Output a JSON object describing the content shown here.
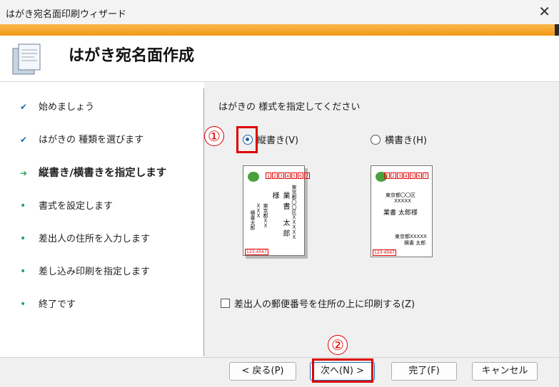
{
  "window": {
    "title": "はがき宛名面印刷ウィザード",
    "close_glyph": "✕"
  },
  "header": {
    "heading": "はがき宛名面作成",
    "icon": "document-icon"
  },
  "steps": [
    {
      "label": "始めましょう",
      "state": "done",
      "mark": "✔"
    },
    {
      "label": "はがきの 種類を選びます",
      "state": "done",
      "mark": "✔"
    },
    {
      "label": "縦書き/横書きを指定します",
      "state": "current",
      "mark": "➔"
    },
    {
      "label": "書式を設定します",
      "state": "todo",
      "mark": "•"
    },
    {
      "label": "差出人の住所を入力します",
      "state": "todo",
      "mark": "•"
    },
    {
      "label": "差し込み印刷を指定します",
      "state": "todo",
      "mark": "•"
    },
    {
      "label": "終了です",
      "state": "todo",
      "mark": "•"
    }
  ],
  "main": {
    "instruction": "はがきの 様式を指定してください",
    "orientation": {
      "vertical_label": "縦書き(V)",
      "horizontal_label": "横書き(H)",
      "selected": "vertical"
    },
    "preview": {
      "zip_digits": [
        "1",
        "2",
        "3",
        "4",
        "5",
        "6",
        "7"
      ],
      "recipient_name_vertical": "業書 太郎様",
      "recipient_addr_vertical": "東京都〇〇区ＸＸＸＸＸ",
      "sender_addr_vertical": "東京都ＸＸＸＸＸ",
      "sender_name_vertical": "横書太郎",
      "recipient_addr_horizontal": "東京都〇〇区",
      "recipient_addr2_horizontal": "XXXXX",
      "recipient_name_horizontal": "業書 太郎様",
      "sender_addr_horizontal": "東京都XXXXX",
      "sender_name_horizontal": "横書 太郎",
      "sender_zip": "123-4567"
    },
    "print_sender_zip_label": "差出人の郵便番号を住所の上に印刷する(Z)",
    "print_sender_zip_checked": false
  },
  "annotations": {
    "badge1": "①",
    "badge2": "②"
  },
  "buttons": {
    "back": "< 戻る(P)",
    "next": "次へ(N) >",
    "finish": "完了(F)",
    "cancel": "キャンセル"
  },
  "colors": {
    "accent": "#f39a16",
    "highlight": "#dd0000",
    "selection": "#1c5fa8"
  }
}
